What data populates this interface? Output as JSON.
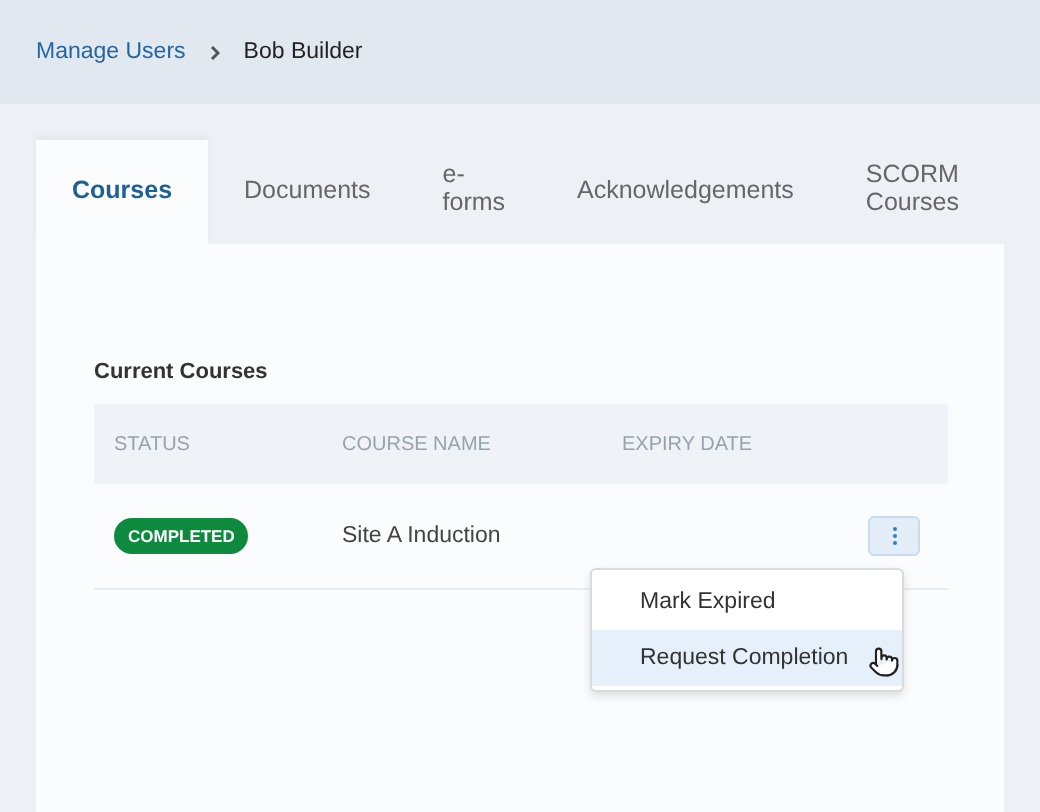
{
  "breadcrumb": [
    {
      "label": "Manage Users",
      "kind": "link"
    },
    {
      "label": "Bob Builder",
      "kind": "current"
    }
  ],
  "tabs": [
    {
      "label": "Courses",
      "selected": true
    },
    {
      "label": "Documents",
      "selected": false
    },
    {
      "label": "e-\nforms",
      "selected": false
    },
    {
      "label": "Acknowledgements",
      "selected": false
    },
    {
      "label": "SCORM\nCourses",
      "selected": false
    }
  ],
  "section_title": "Current Courses",
  "table": {
    "columns": [
      "STATUS",
      "COURSE NAME",
      "EXPIRY DATE"
    ],
    "rows": [
      {
        "status": "COMPLETED",
        "color": "#0e8a3e",
        "course_name": "Site A Induction"
      }
    ]
  },
  "menu": {
    "items": [
      {
        "label": "Mark Expired",
        "selected": false
      },
      {
        "label": "Request Completion",
        "selected": true
      }
    ]
  }
}
